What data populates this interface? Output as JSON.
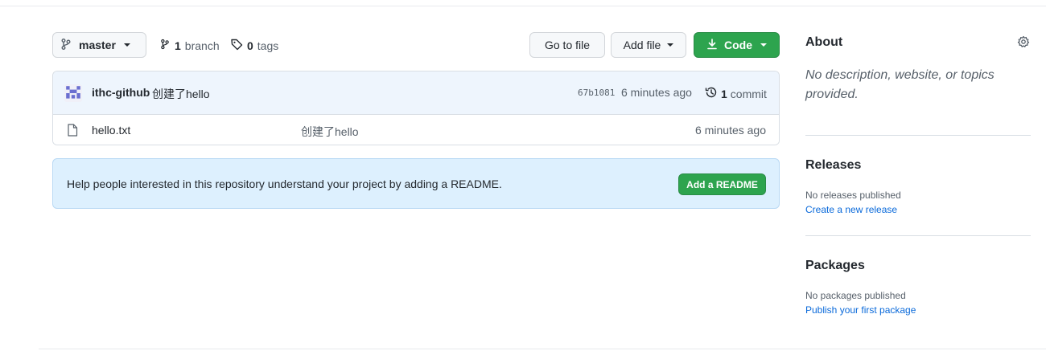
{
  "toolbar": {
    "branch_name": "master",
    "branch_count": "1",
    "branch_label": "branch",
    "tag_count": "0",
    "tag_label": "tags",
    "go_to_file": "Go to file",
    "add_file": "Add file",
    "code": "Code"
  },
  "latest_commit": {
    "author": "ithc-github",
    "message": "创建了hello",
    "sha": "67b1081",
    "time": "6 minutes ago",
    "commit_count": "1",
    "commit_label": "commit"
  },
  "files": [
    {
      "name": "hello.txt",
      "message": "创建了hello",
      "time": "6 minutes ago"
    }
  ],
  "readme_banner": {
    "text": "Help people interested in this repository understand your project by adding a README.",
    "button": "Add a README"
  },
  "sidebar": {
    "about": {
      "title": "About",
      "description": "No description, website, or topics provided."
    },
    "releases": {
      "title": "Releases",
      "status": "No releases published",
      "link": "Create a new release"
    },
    "packages": {
      "title": "Packages",
      "status": "No packages published",
      "link": "Publish your first package"
    }
  },
  "colors": {
    "primary_green": "#2da44e",
    "link_blue": "#0969da",
    "commit_bar": "#eef5fd",
    "readme_banner": "#ddf0fe"
  }
}
